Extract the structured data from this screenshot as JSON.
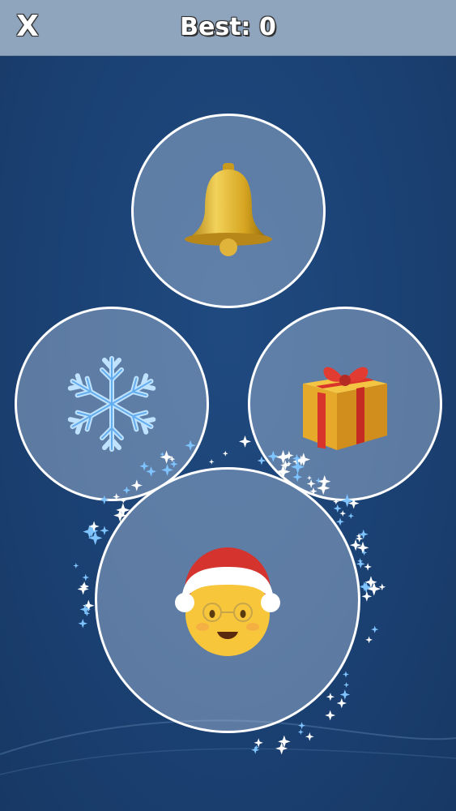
{
  "header": {
    "close_label": "X",
    "best_label": "Best: 0"
  },
  "items": [
    {
      "name": "bell",
      "icon": "bell-icon"
    },
    {
      "name": "snowflake",
      "icon": "snowflake-icon"
    },
    {
      "name": "gift",
      "icon": "gift-icon"
    },
    {
      "name": "mrs-claus",
      "icon": "mrs-claus-icon",
      "highlighted": true
    }
  ],
  "colors": {
    "background": "#1b4173",
    "topbar": "#8fa4bd",
    "bubble_border": "#ffffff"
  }
}
